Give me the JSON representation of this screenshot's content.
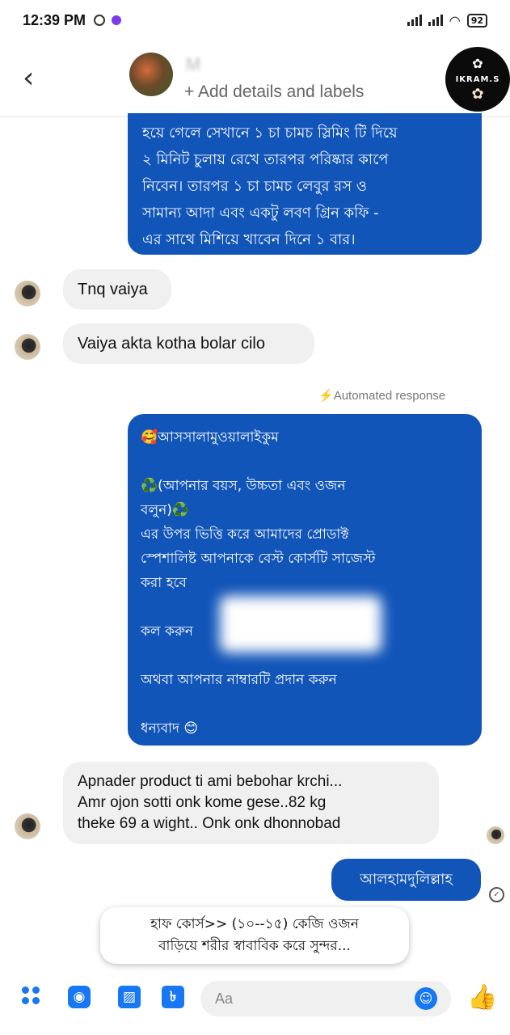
{
  "status_bar": {
    "time": "12:39 PM",
    "battery": "92"
  },
  "header": {
    "contact_name": "M",
    "add_details": "+ Add details and labels",
    "brand_badge": "IKRAM.S"
  },
  "messages": {
    "m1": "হয়ে গেলে সেখানে ১ চা চামচ স্লিমিং টি দিয়ে\n২ মিনিট চুলায় রেখে তারপর পরিষ্কার কাপে\nনিবেন। তারপর ১ চা চামচ লেবুর রস ও\nসামান্য আদা এবং একটু লবণ গ্রিন কফি -\nএর সাথে মিশিয়ে খাবেন দিনে ১ বার।",
    "m2": "Tnq vaiya",
    "m3": "Vaiya akta kotha bolar cilo",
    "automated_label": "Automated response",
    "m4": "🥰আসসালামুওয়ালাইকুম\n\n♻️(আপনার বয়স, উচ্চতা এবং ওজন\nবলুন)♻️\nএর উপর ভিত্তি করে আমাদের প্রোডাক্ট\nস্পেশালিষ্ট আপনাকে বেস্ট কোর্সটি সাজেস্ট\nকরা হবে\n\nকল করুন\n\nঅথবা আপনার নাম্বারটি প্রদান করুন\n\nধন্যবাদ 😊",
    "m5": "Apnader product ti ami bebohar krchi...\nAmr ojon sotti onk kome gese..82 kg\ntheke 69 a wight.. Onk onk dhonnobad",
    "m6": "আলহামদুলিল্লাহ"
  },
  "suggestion": "হাফ কোর্স>> (১০--১৫) কেজি ওজন\nবাড়িয়ে শরীর স্বাবাবিক করে সুন্দর...",
  "composer": {
    "placeholder": "Aa"
  },
  "icons": {
    "back": "back-arrow-icon",
    "camera": "camera-icon",
    "image": "image-icon",
    "like": "thumbs-up-icon"
  },
  "colors": {
    "outgoing_bubble": "#1255b9",
    "incoming_bubble": "#f0f0f0",
    "accent": "#1877f2"
  }
}
